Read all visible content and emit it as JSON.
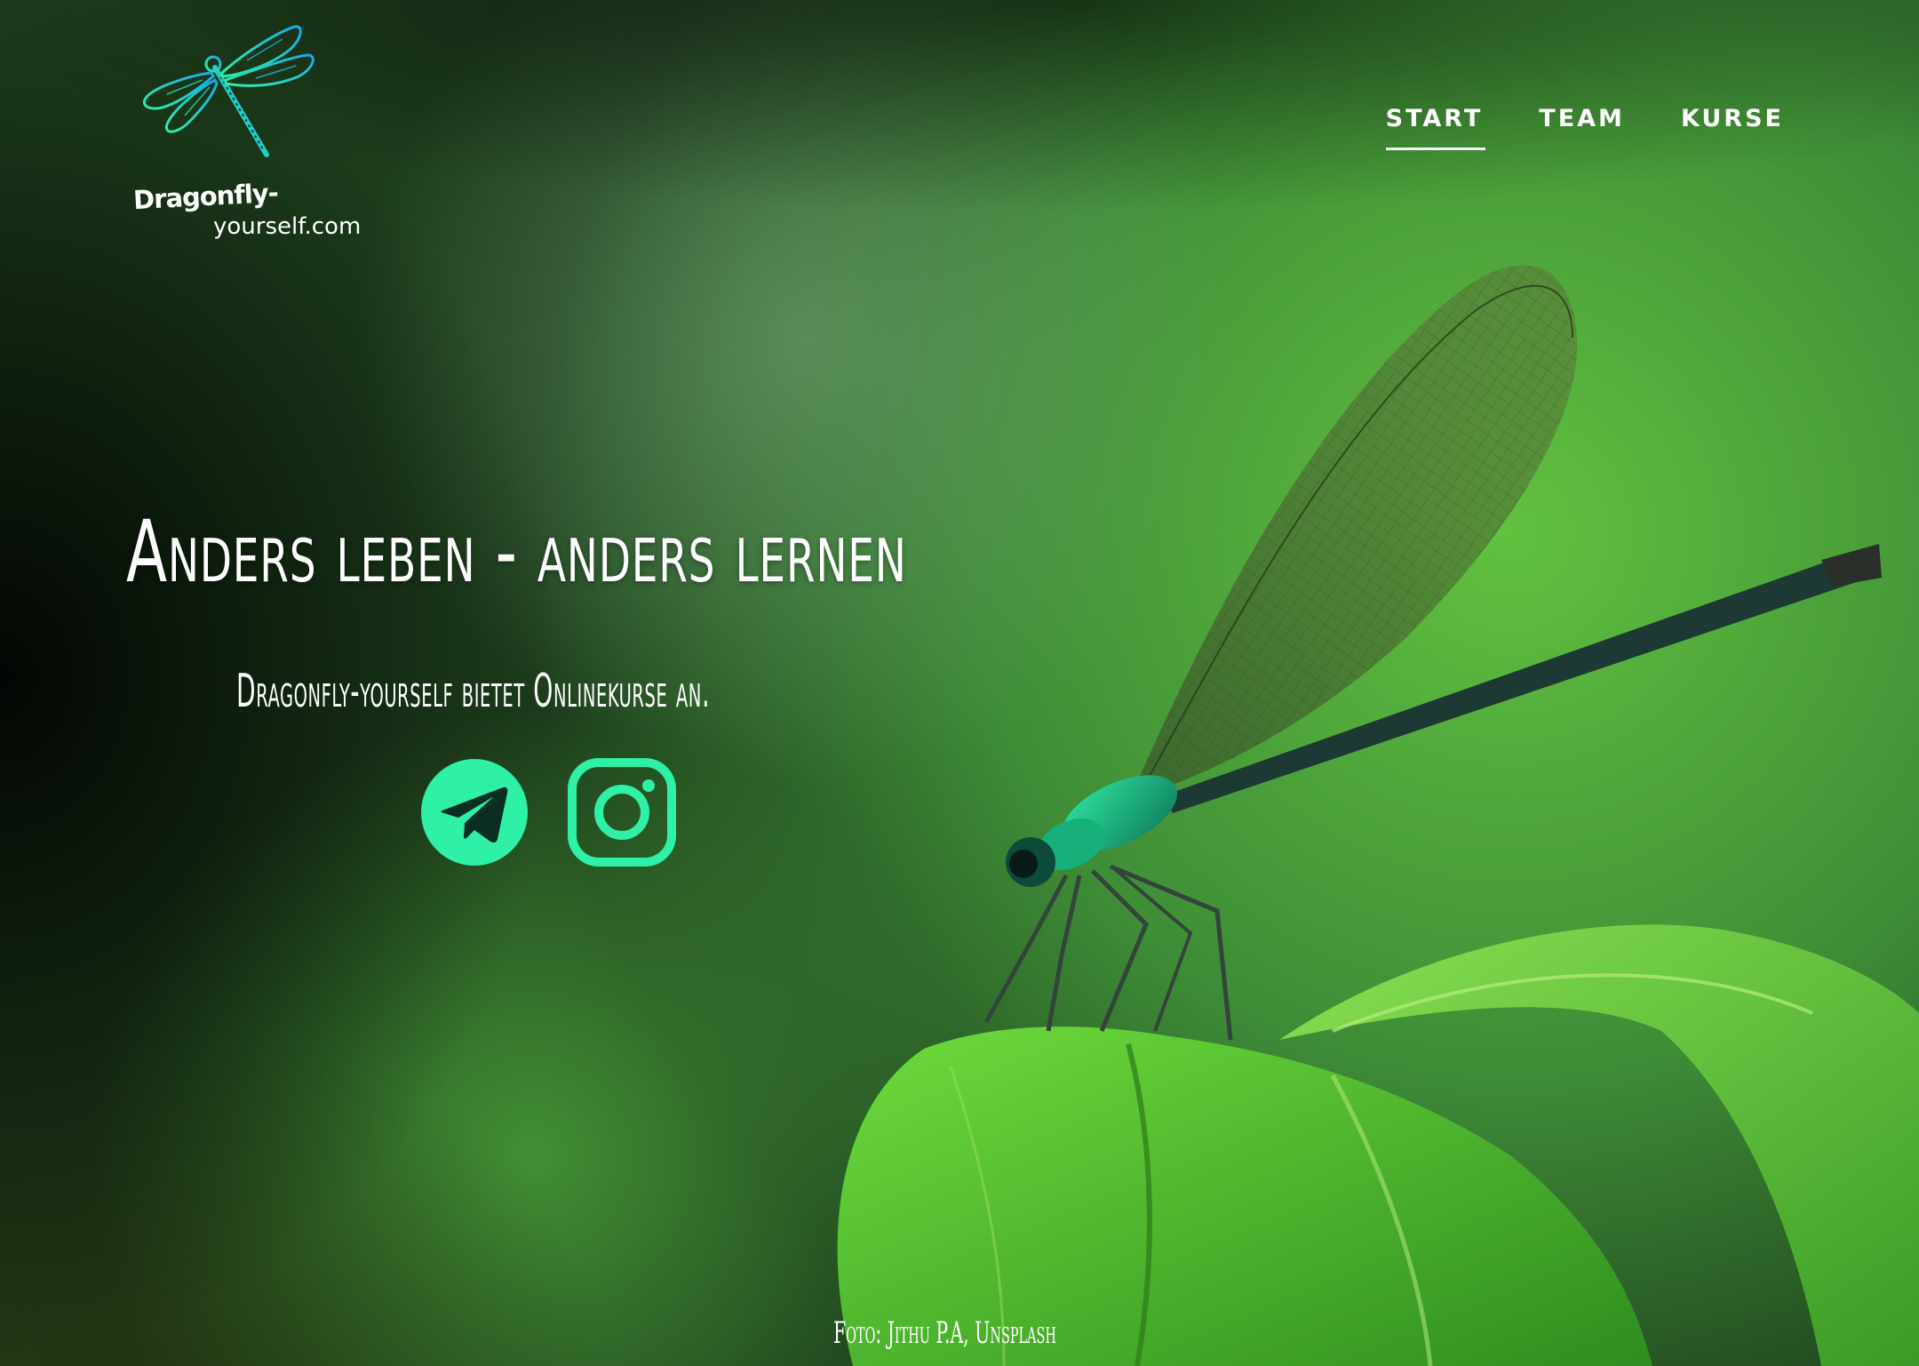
{
  "logo": {
    "line1": "Dragonfly-",
    "line2": "yourself.com"
  },
  "nav": {
    "items": [
      {
        "label": "START",
        "active": true
      },
      {
        "label": "TEAM",
        "active": false
      },
      {
        "label": "KURSE",
        "active": false
      }
    ]
  },
  "hero": {
    "headline": "Anders leben - anders lernen",
    "subline": "Dragonfly-yourself bietet Onlinekurse an.",
    "socials": [
      {
        "icon": "telegram-icon"
      },
      {
        "icon": "instagram-icon"
      }
    ]
  },
  "footer": {
    "credit": "Foto: Jithu P.A, Unsplash"
  },
  "colors": {
    "accent": "#2ef0a6",
    "text": "#ffffff",
    "bg_green": "#3f9a34"
  }
}
